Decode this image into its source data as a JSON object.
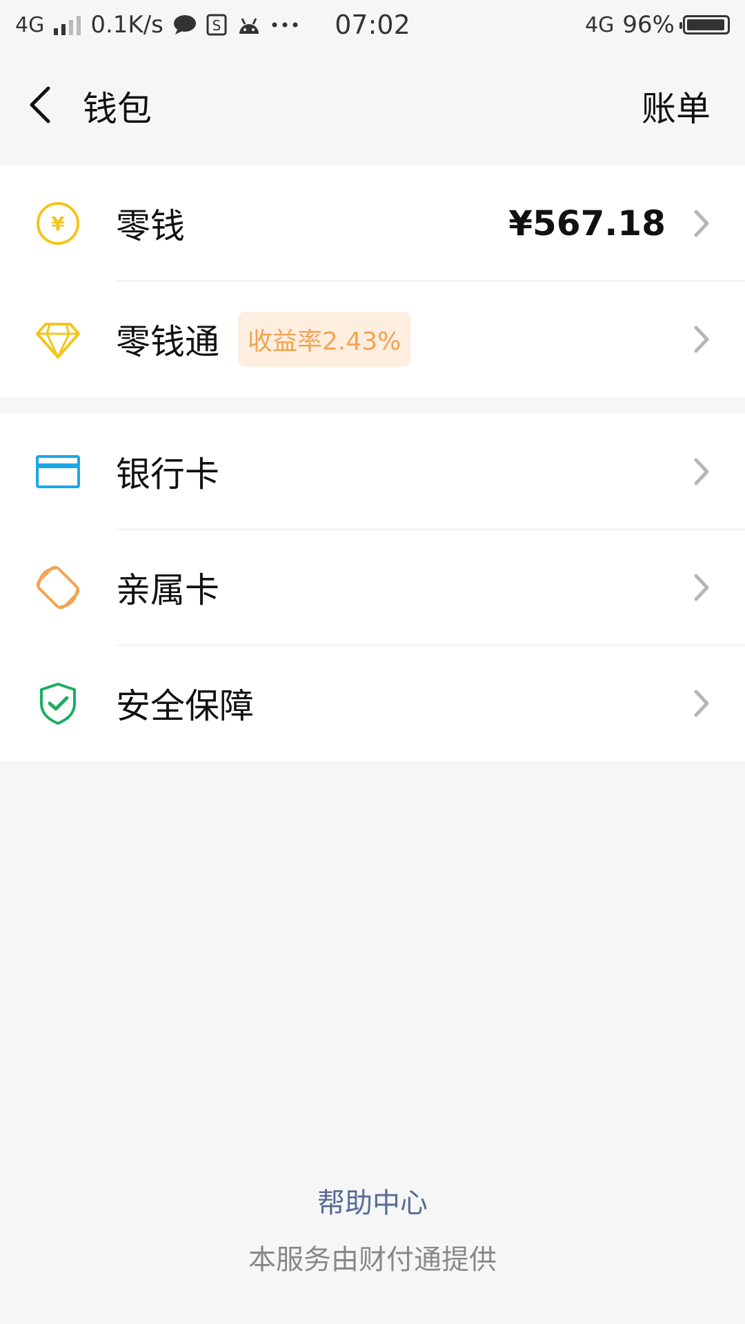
{
  "status_bar": {
    "network_left": "4G",
    "speed": "0.1K/s",
    "time": "07:02",
    "network_right": "4G",
    "battery": "96%",
    "icons": [
      "signal-icon",
      "chat-bubble-icon",
      "sim-icon",
      "android-icon",
      "more-dots-icon",
      "battery-icon"
    ]
  },
  "nav": {
    "title": "钱包",
    "bill": "账单"
  },
  "group1": [
    {
      "label": "零钱",
      "amount": "¥567.18",
      "icon": "yuan-coin-icon",
      "color": "#f5c518"
    },
    {
      "label": "零钱通",
      "badge": "收益率2.43%",
      "icon": "diamond-icon",
      "color": "#f5c518"
    }
  ],
  "group2": [
    {
      "label": "银行卡",
      "icon": "bank-card-icon",
      "color": "#1aa8e8"
    },
    {
      "label": "亲属卡",
      "icon": "family-card-icon",
      "color": "#f2a451"
    },
    {
      "label": "安全保障",
      "icon": "shield-check-icon",
      "color": "#1aad60"
    }
  ],
  "footer": {
    "help": "帮助中心",
    "note": "本服务由财付通提供"
  }
}
